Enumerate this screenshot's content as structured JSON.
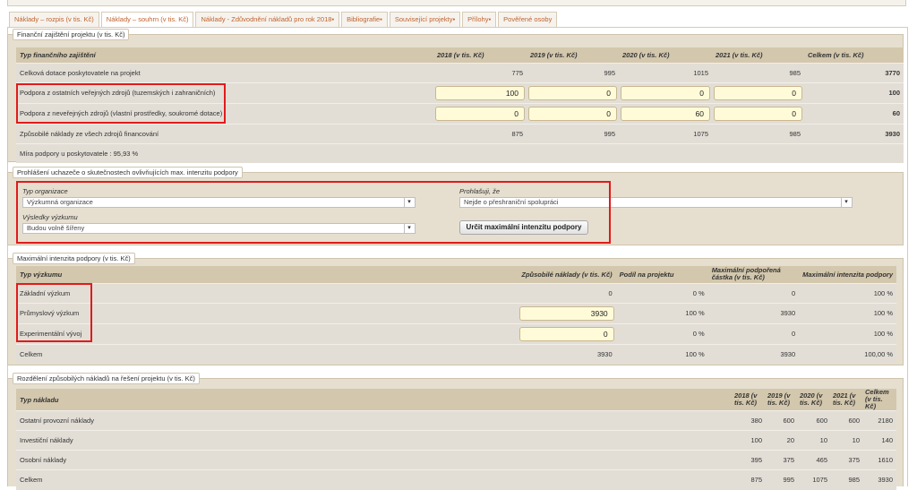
{
  "tabs": [
    {
      "label": "Náklady – rozpis (v tis. Kč)"
    },
    {
      "label": "Náklady – souhrn (v tis. Kč)"
    },
    {
      "label": "Náklady - Zdůvodnění nákladů pro rok 2018▪"
    },
    {
      "label": "Bibliografie▪"
    },
    {
      "label": "Související projekty▪"
    },
    {
      "label": "Přílohy▪"
    },
    {
      "label": "Pověřené osoby"
    }
  ],
  "funding": {
    "legend": "Finanční zajištění projektu (v tis. Kč)",
    "headers": [
      "Typ finančního zajištění",
      "2018 (v tis. Kč)",
      "2019 (v tis. Kč)",
      "2020 (v tis. Kč)",
      "2021 (v tis. Kč)",
      "Celkem (v tis. Kč)"
    ],
    "rows": [
      {
        "label": "Celková dotace poskytovatele na projekt",
        "values": [
          "775",
          "995",
          "1015",
          "985"
        ],
        "total": "3770"
      },
      {
        "label": "Podpora z ostatních veřejných zdrojů (tuzemských i zahraničních)",
        "values": [
          "100",
          "0",
          "0",
          "0"
        ],
        "total": "100"
      },
      {
        "label": "Podpora z neveřejných zdrojů (vlastní prostředky, soukromé dotace)",
        "values": [
          "0",
          "0",
          "60",
          "0"
        ],
        "total": "60"
      },
      {
        "label": "Způsobilé náklady ze všech zdrojů financování",
        "values": [
          "875",
          "995",
          "1075",
          "985"
        ],
        "total": "3930"
      }
    ],
    "support_rate": "Míra podpory u poskytovatele : 95,93 %"
  },
  "declaration": {
    "legend": "Prohlášení uchazeče o skutečnostech ovlivňujících max. intenzitu podpory",
    "org_type_label": "Typ organizace",
    "org_type_value": "Výzkumná organizace",
    "results_label": "Výsledky výzkumu",
    "results_value": "Budou volně šířeny",
    "declare_label": "Prohlašuji, že",
    "declare_value": "Nejde o přeshraniční spolupráci",
    "button": "Určit maximální intenzitu podpory"
  },
  "intensity": {
    "legend": "Maximální intenzita podpory (v tis. Kč)",
    "headers": [
      "Typ výzkumu",
      "Způsobilé náklady (v tis. Kč)",
      "Podíl na projektu",
      "Maximální podpořená částka (v tis. Kč)",
      "Maximální intenzita podpory"
    ],
    "rows": [
      {
        "label": "Základní výzkum",
        "cost": "0",
        "share": "0 %",
        "max_amount": "0",
        "max_intensity": "100 %"
      },
      {
        "label": "Průmyslový výzkum",
        "cost": "3930",
        "share": "100 %",
        "max_amount": "3930",
        "max_intensity": "100 %"
      },
      {
        "label": "Experimentální vývoj",
        "cost": "0",
        "share": "0 %",
        "max_amount": "0",
        "max_intensity": "100 %"
      },
      {
        "label": "Celkem",
        "cost": "3930",
        "share": "100 %",
        "max_amount": "3930",
        "max_intensity": "100,00 %"
      }
    ]
  },
  "distribution": {
    "legend": "Rozdělení způsobilých nákladů na řešení projektu (v tis. Kč)",
    "headers": [
      "Typ nákladu",
      "2018 (v tis. Kč)",
      "2019 (v tis. Kč)",
      "2020 (v tis. Kč)",
      "2021 (v tis. Kč)",
      "Celkem (v tis. Kč)"
    ],
    "rows": [
      {
        "label": "Ostatní provozní náklady",
        "values": [
          "380",
          "600",
          "600",
          "600",
          "2180"
        ]
      },
      {
        "label": "Investiční náklady",
        "values": [
          "100",
          "20",
          "10",
          "10",
          "140"
        ]
      },
      {
        "label": "Osobní náklady",
        "values": [
          "395",
          "375",
          "465",
          "375",
          "1610"
        ]
      },
      {
        "label": "Celkem",
        "values": [
          "875",
          "995",
          "1075",
          "985",
          "3930"
        ]
      }
    ]
  }
}
